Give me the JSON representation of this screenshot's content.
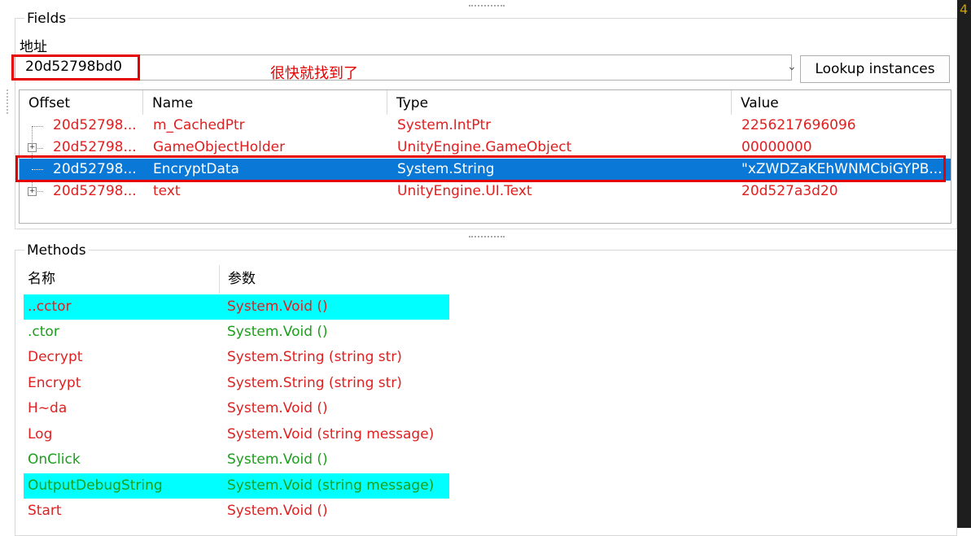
{
  "fields": {
    "title": "Fields",
    "address_label": "地址",
    "address_value": "20d52798bd0",
    "annotation": "很快就找到了",
    "lookup_button": "Lookup instances",
    "columns": {
      "offset": "Offset",
      "name": "Name",
      "type": "Type",
      "value": "Value"
    },
    "rows": [
      {
        "offset": "20d52798...",
        "name": "m_CachedPtr",
        "type": "System.IntPtr",
        "value": "2256217696096",
        "expandable": false,
        "selected": false
      },
      {
        "offset": "20d52798...",
        "name": "GameObjectHolder",
        "type": "UnityEngine.GameObject",
        "value": "00000000",
        "expandable": true,
        "selected": false
      },
      {
        "offset": "20d52798...",
        "name": "EncryptData",
        "type": "System.String",
        "value": "\"xZWDZaKEhWNMCbiGYPB...",
        "expandable": false,
        "selected": true
      },
      {
        "offset": "20d52798...",
        "name": "text",
        "type": "UnityEngine.UI.Text",
        "value": "20d527a3d20",
        "expandable": true,
        "selected": false
      }
    ]
  },
  "methods": {
    "title": "Methods",
    "columns": {
      "name": "名称",
      "params": "参数"
    },
    "rows": [
      {
        "name": "..cctor",
        "params": "System.Void ()",
        "color": "red",
        "highlight": true
      },
      {
        "name": ".ctor",
        "params": "System.Void ()",
        "color": "green",
        "highlight": false
      },
      {
        "name": "Decrypt",
        "params": "System.String (string str)",
        "color": "red",
        "highlight": false
      },
      {
        "name": "Encrypt",
        "params": "System.String (string str)",
        "color": "red",
        "highlight": false
      },
      {
        "name": "H~da",
        "params": "System.Void ()",
        "color": "red",
        "highlight": false
      },
      {
        "name": "Log",
        "params": "System.Void (string message)",
        "color": "red",
        "highlight": false
      },
      {
        "name": "OnClick",
        "params": "System.Void ()",
        "color": "green",
        "highlight": false
      },
      {
        "name": "OutputDebugString",
        "params": "System.Void (string message)",
        "color": "green",
        "highlight": true
      },
      {
        "name": "Start",
        "params": "System.Void ()",
        "color": "red",
        "highlight": false
      }
    ]
  },
  "colors": {
    "selection": "#0a78d7",
    "highlight": "#00ffff",
    "annotation_red": "#e60000"
  },
  "edge_glyph": "4"
}
